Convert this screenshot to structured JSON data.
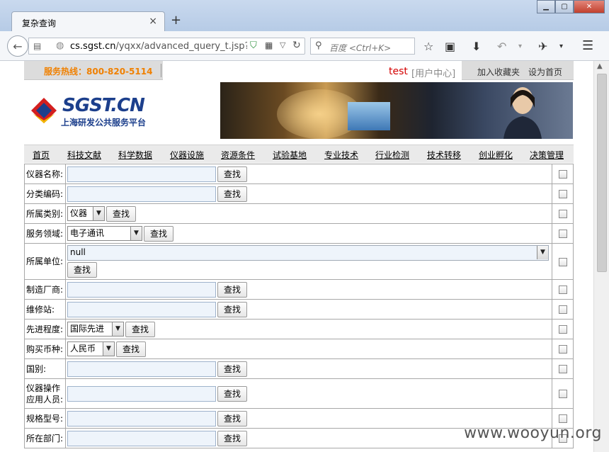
{
  "browser": {
    "tab_title": "复杂查询",
    "tab_close": "×",
    "new_tab": "+",
    "url_host": "cs.sgst.cn",
    "url_path": "/yqxx/advanced_query_t.jsp?ssoSt",
    "search_placeholder": "百度 <Ctrl+K>"
  },
  "header": {
    "hotline": "服务热线：800-820-5114",
    "user_name": "test",
    "user_center": "[用户中心]",
    "add_favorite": "加入收藏夹",
    "set_home": "设为首页"
  },
  "logo": {
    "text": "SGST.CN",
    "subtitle": "上海研发公共服务平台"
  },
  "nav": [
    {
      "label": "首页"
    },
    {
      "label": "科技文献"
    },
    {
      "label": "科学数据"
    },
    {
      "label": "仪器设施"
    },
    {
      "label": "资源条件"
    },
    {
      "label": "试验基地"
    },
    {
      "label": "专业技术"
    },
    {
      "label": "行业检测"
    },
    {
      "label": "技术转移"
    },
    {
      "label": "创业孵化"
    },
    {
      "label": "决策管理"
    }
  ],
  "form": {
    "search_button": "查找",
    "rows": [
      {
        "label": "仪器名称:",
        "kind": "text",
        "value": ""
      },
      {
        "label": "分类编码:",
        "kind": "text",
        "value": ""
      },
      {
        "label": "所属类别:",
        "kind": "select",
        "value": "仪器"
      },
      {
        "label": "服务领域:",
        "kind": "select",
        "value": "电子通讯"
      },
      {
        "label": "所属单位:",
        "kind": "select-wide",
        "value": "null"
      },
      {
        "label": "制造厂商:",
        "kind": "text",
        "value": ""
      },
      {
        "label": "维修站:",
        "kind": "text",
        "value": ""
      },
      {
        "label": "先进程度:",
        "kind": "select",
        "value": "国际先进"
      },
      {
        "label": "购买币种:",
        "kind": "select",
        "value": "人民币"
      },
      {
        "label": "国别:",
        "kind": "text",
        "value": ""
      },
      {
        "label": "仪器操作应用人员:",
        "kind": "text",
        "value": ""
      },
      {
        "label": "规格型号:",
        "kind": "text",
        "value": ""
      },
      {
        "label": "所在部门:",
        "kind": "text",
        "value": ""
      }
    ]
  },
  "watermark": "www.wooyun.org"
}
